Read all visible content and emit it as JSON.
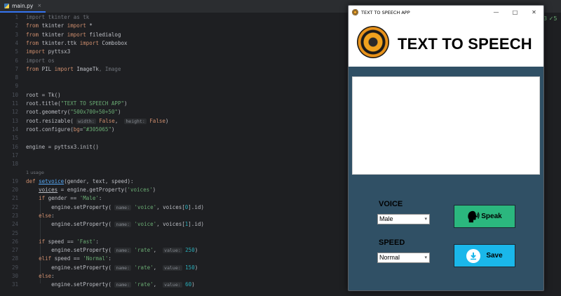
{
  "editor": {
    "tab_label": "main.py",
    "tab_close": "×",
    "usage_hint": "1 usage",
    "right_marks": "3 ✓5",
    "lines": [
      {
        "n": "1"
      },
      {
        "n": "2"
      },
      {
        "n": "3"
      },
      {
        "n": "4"
      },
      {
        "n": "5"
      },
      {
        "n": "6"
      },
      {
        "n": "7"
      },
      {
        "n": "8"
      },
      {
        "n": "9"
      },
      {
        "n": "10"
      },
      {
        "n": "11"
      },
      {
        "n": "12"
      },
      {
        "n": "13"
      },
      {
        "n": "14"
      },
      {
        "n": "15"
      },
      {
        "n": "16"
      },
      {
        "n": "17"
      },
      {
        "n": "18"
      },
      {
        "n": "19"
      },
      {
        "n": "20"
      },
      {
        "n": "21"
      },
      {
        "n": "22"
      },
      {
        "n": "23"
      },
      {
        "n": "24"
      },
      {
        "n": "25"
      },
      {
        "n": "26"
      },
      {
        "n": "27"
      },
      {
        "n": "28"
      },
      {
        "n": "29"
      },
      {
        "n": "30"
      },
      {
        "n": "31"
      }
    ]
  },
  "app": {
    "window_title": "TEXT TO SPEECH APP",
    "minimize": "—",
    "maximize": "□",
    "close": "✕",
    "heading": "TEXT TO SPEECH",
    "voice_label": "VOICE",
    "voice_value": "Male",
    "speed_label": "SPEED",
    "speed_value": "Normal",
    "speak_label": "Speak",
    "save_label": "Save",
    "background_color": "#305065",
    "speak_color": "#2bb77e",
    "save_color": "#1ab7ea"
  }
}
